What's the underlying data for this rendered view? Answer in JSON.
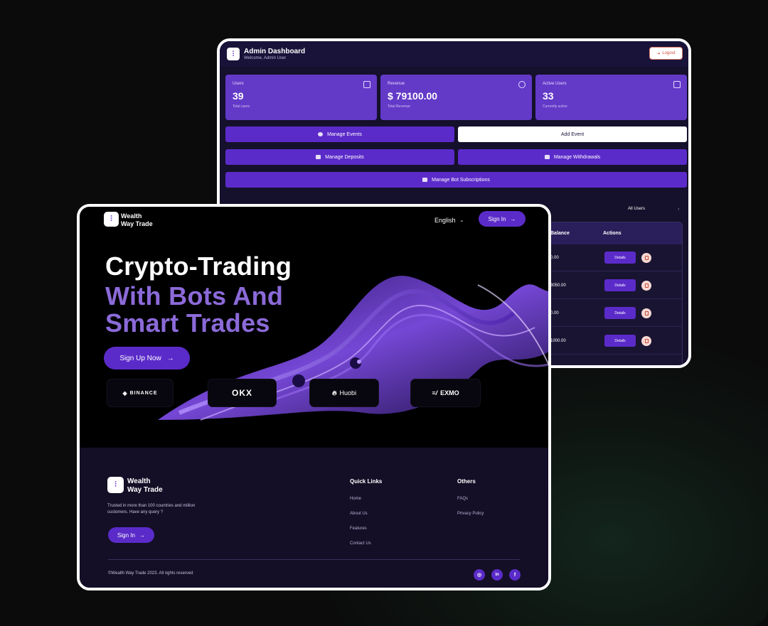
{
  "admin": {
    "title": "Admin Dashboard",
    "subtitle": "Welcome, Admin User",
    "logout_label": "Logout",
    "stats": [
      {
        "label": "Users",
        "value": "39",
        "sub": "Total users"
      },
      {
        "label": "Revenue",
        "value": "$ 79100.00",
        "sub": "Total Revenue"
      },
      {
        "label": "Active Users",
        "value": "33",
        "sub": "Currently active"
      }
    ],
    "buttons": {
      "manage_events": "Manage Events",
      "add_event": "Add Event",
      "manage_deposits": "Manage Deposits",
      "manage_withdrawals": "Manage Withdrawals",
      "manage_bot_subscriptions": "Manage Bot Subscriptions"
    },
    "filter_label": "All Users",
    "table": {
      "headers": {
        "balance": "Balance",
        "actions": "Actions"
      },
      "rows": [
        {
          "balance": "0.00",
          "details": "Details"
        },
        {
          "balance": "3050.00",
          "details": "Details"
        },
        {
          "balance": "0.00",
          "details": "Details"
        },
        {
          "balance": "1000.00",
          "details": "Details"
        }
      ]
    }
  },
  "landing": {
    "brand_line1": "Wealth",
    "brand_line2": "Way Trade",
    "language": "English",
    "signin_label": "Sign In",
    "hero": {
      "line1": "Crypto-Trading",
      "line2": "With Bots And",
      "line3": "Smart Trades"
    },
    "signup_label": "Sign Up Now",
    "exchanges": [
      "BINANCE",
      "OKX",
      "Huobi",
      "EXMO"
    ],
    "footer": {
      "brand_line1": "Wealth",
      "brand_line2": "Way Trade",
      "text": "Trusted in more than 100 countries and million customers. Have any query ?",
      "signin_label": "Sign In",
      "quick_links_title": "Quick Links",
      "quick_links": [
        "Home",
        "About Us",
        "Features",
        "Contact Us"
      ],
      "others_title": "Others",
      "others": [
        "FAQs",
        "Privacy Policy"
      ],
      "copyright": "©Wealth Way Trade 2023. All rights reserved",
      "social": [
        "instagram-icon",
        "linkedin-icon",
        "facebook-icon"
      ]
    }
  },
  "colors": {
    "accent": "#5b2bc9",
    "card": "#6339c8",
    "panel_dark": "#15102b",
    "footer_bg": "#140f26"
  }
}
